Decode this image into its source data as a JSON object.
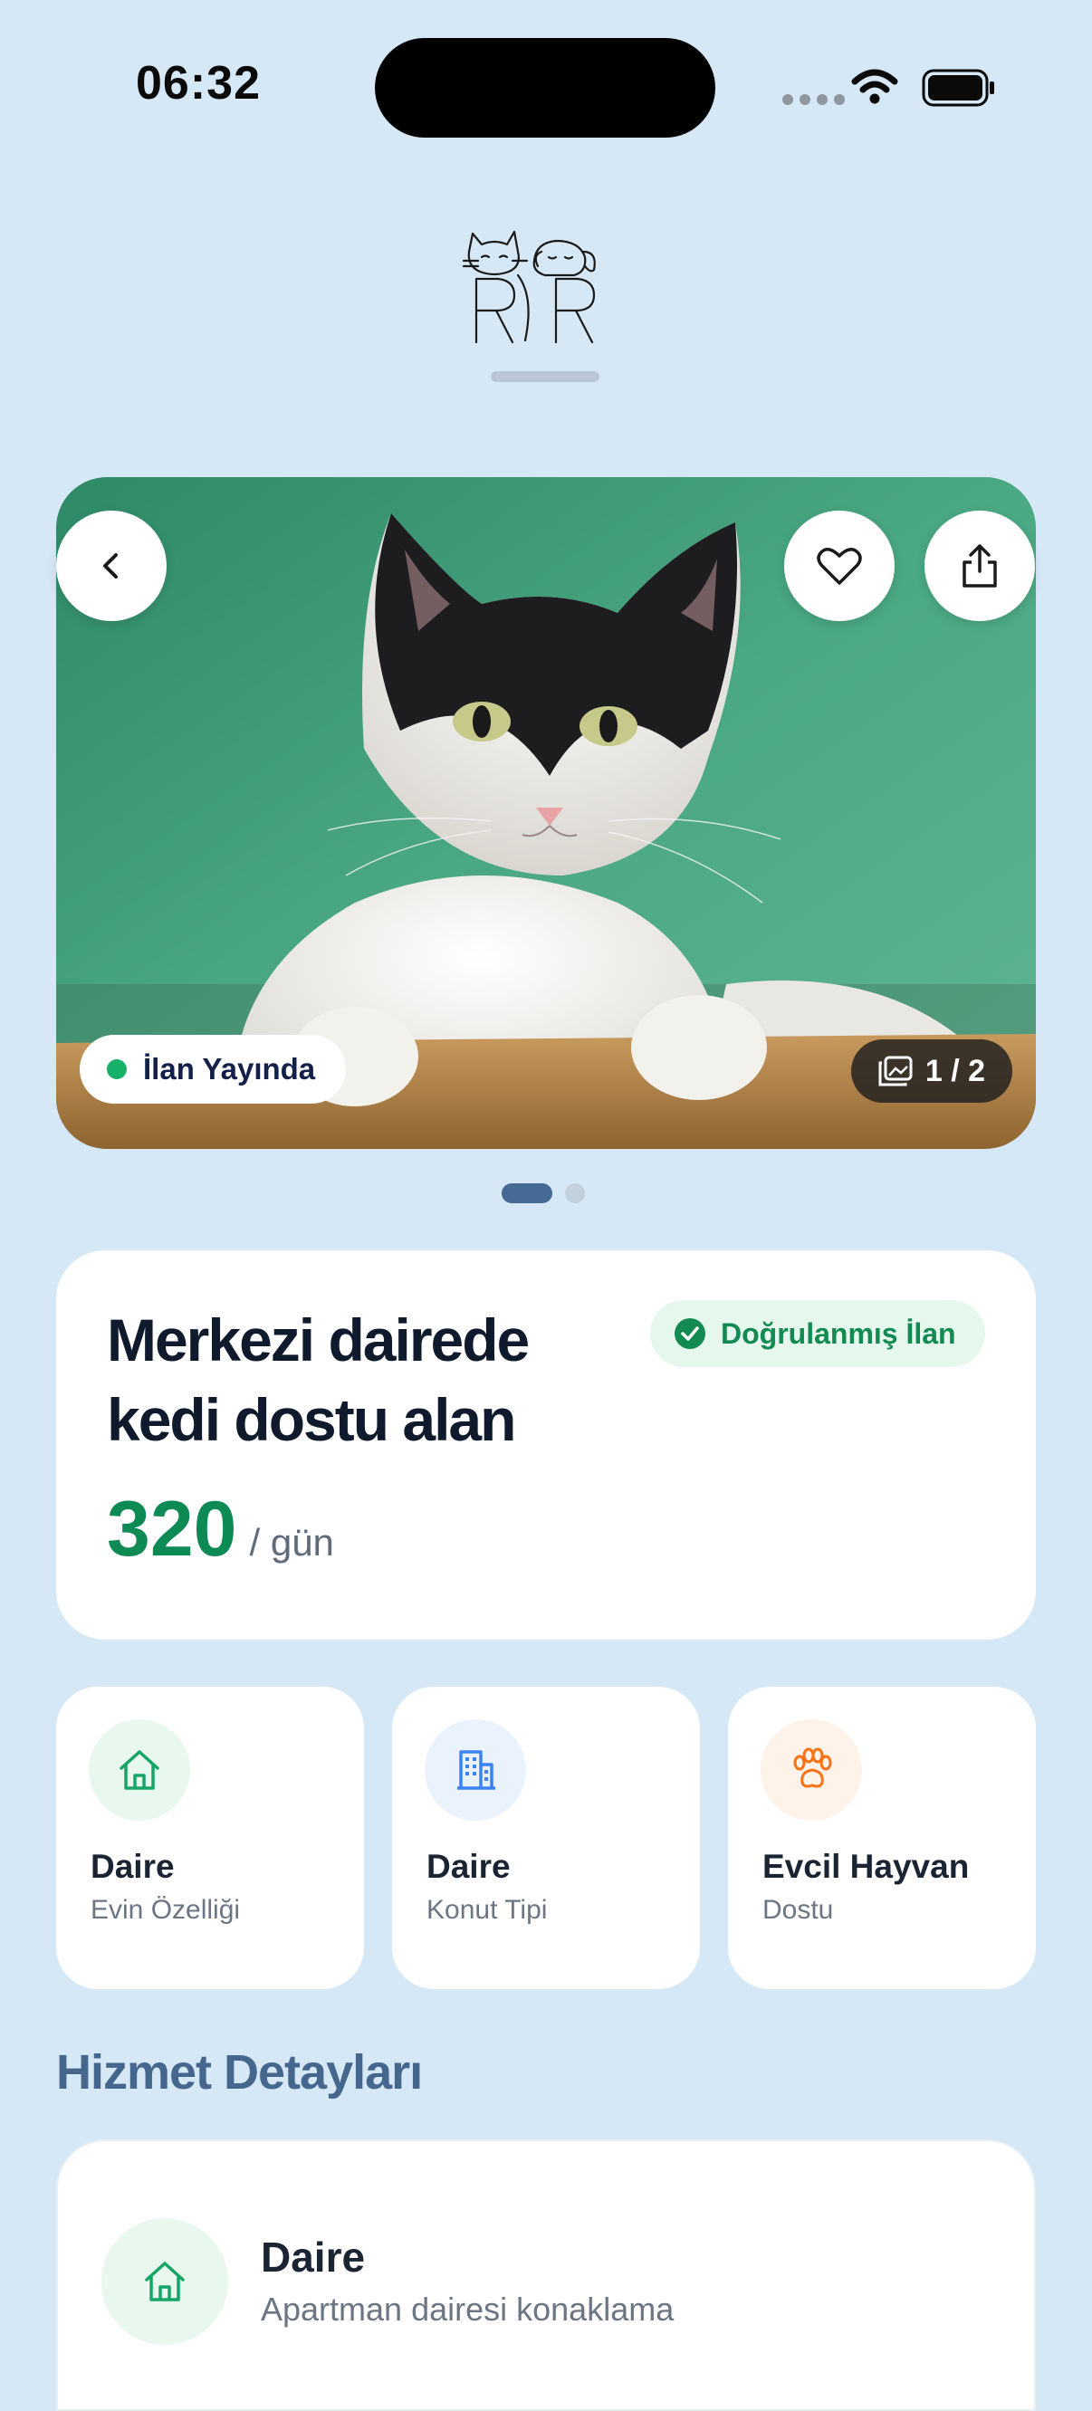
{
  "status_bar": {
    "time": "06:32"
  },
  "listing": {
    "status": "İlan Yayında",
    "image_counter": "1 / 2",
    "title": "Merkezi dairede kedi dostu alan",
    "verified_label": "Doğrulanmış İlan",
    "price": "320",
    "price_unit": "/ gün"
  },
  "features": [
    {
      "title": "Daire",
      "subtitle": "Evin Özelliği",
      "icon": "home-icon",
      "color": "#17a567"
    },
    {
      "title": "Daire",
      "subtitle": "Konut Tipi",
      "icon": "building-icon",
      "color": "#3b82f6"
    },
    {
      "title": "Evcil Hayvan",
      "subtitle": "Dostu",
      "icon": "paw-icon",
      "color": "#f97316"
    }
  ],
  "service_details": {
    "heading": "Hizmet Detayları",
    "items": [
      {
        "title": "Daire",
        "subtitle": "Apartman dairesi konaklama",
        "icon": "home-icon"
      }
    ]
  },
  "colors": {
    "accent_green": "#0e8a55",
    "background": "#d6e8f6",
    "section_heading": "#45668d"
  }
}
